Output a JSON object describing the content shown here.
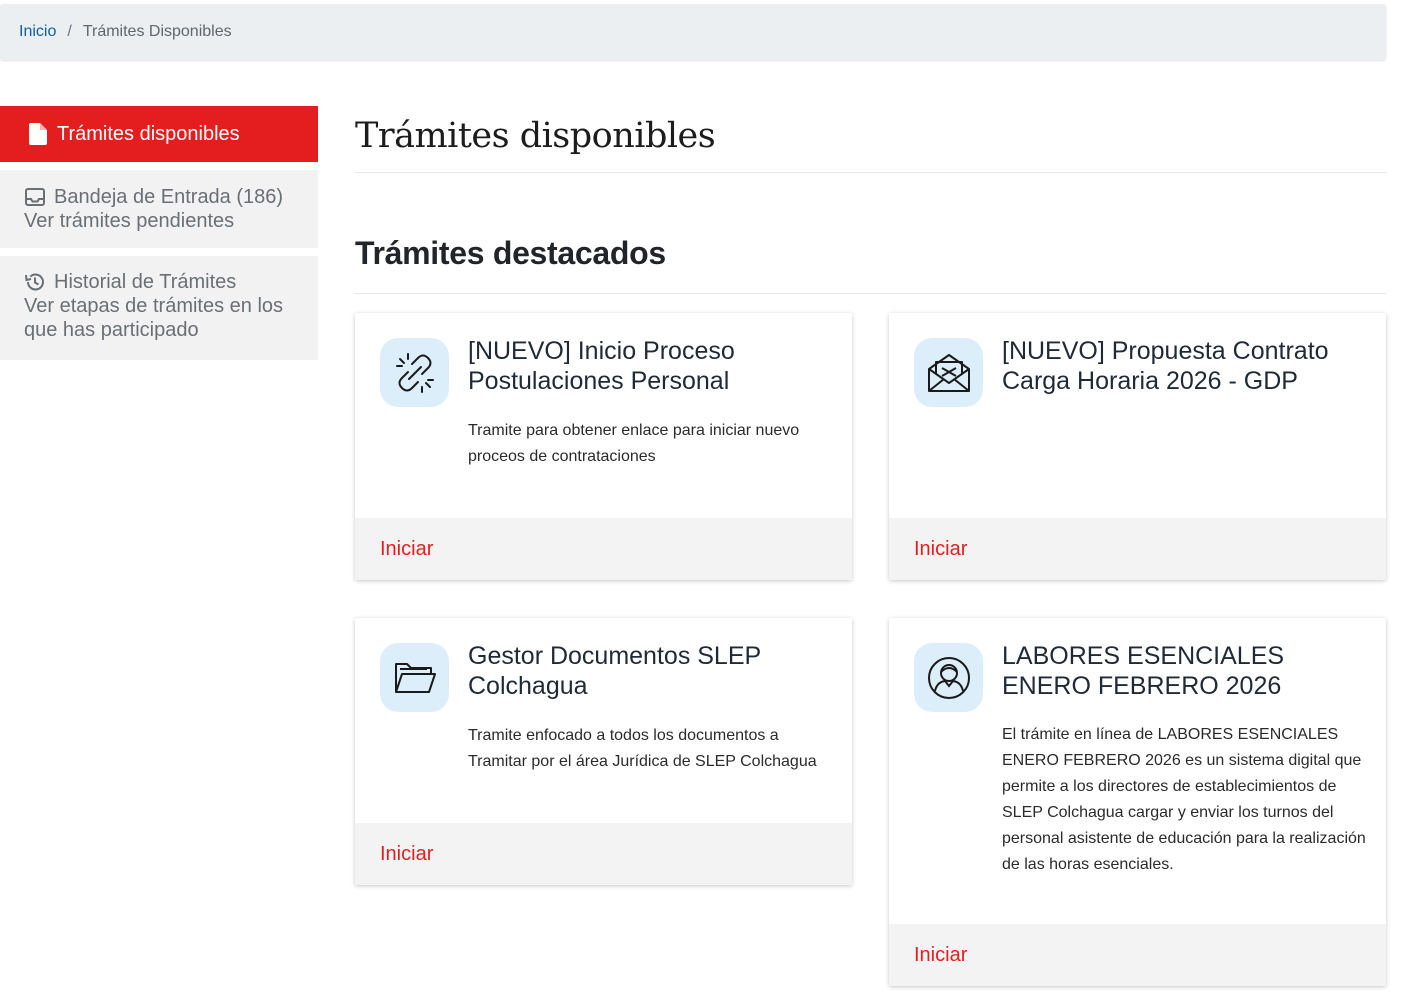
{
  "breadcrumb": {
    "home": "Inicio",
    "separator": "/",
    "current": "Trámites Disponibles"
  },
  "sidebar": {
    "items": [
      {
        "label": "Trámites disponibles",
        "icon": "file-icon"
      },
      {
        "label": "Bandeja de Entrada (186)",
        "sub": "Ver trámites pendientes",
        "icon": "inbox-icon"
      },
      {
        "label": "Historial de Trámites",
        "sub": "Ver etapas de trámites en los que has participado",
        "icon": "history-icon"
      }
    ]
  },
  "main": {
    "title": "Trámites disponibles",
    "section_title": "Trámites destacados"
  },
  "cards": [
    {
      "title": "[NUEVO] Inicio Proceso Postulaciones Personal",
      "description": "Tramite para obtener enlace para iniciar nuevo proceos de contrataciones",
      "action": "Iniciar",
      "icon": "broken-link-icon"
    },
    {
      "title": "[NUEVO] Propuesta Contrato Carga Horaria 2026 - GDP",
      "description": "",
      "action": "Iniciar",
      "icon": "envelope-open-icon"
    },
    {
      "title": "Gestor Documentos SLEP Colchagua",
      "description": "Tramite enfocado a todos los documentos a Tramitar por el área Jurídica de SLEP Colchagua",
      "action": "Iniciar",
      "icon": "folder-open-icon"
    },
    {
      "title": "LABORES ESENCIALES ENERO FEBRERO 2026",
      "description": "El trámite en línea de LABORES ESENCIALES ENERO FEBRERO 2026 es un sistema digital que permite a los directores de establecimientos de SLEP Colchagua cargar y enviar los turnos del personal asistente de educación para la realización de las horas esenciales.",
      "action": "Iniciar",
      "icon": "user-circle-icon"
    }
  ],
  "colors": {
    "accent": "#e41e1e",
    "link": "#0d5fa6",
    "icon_bg": "#ddeefb"
  }
}
